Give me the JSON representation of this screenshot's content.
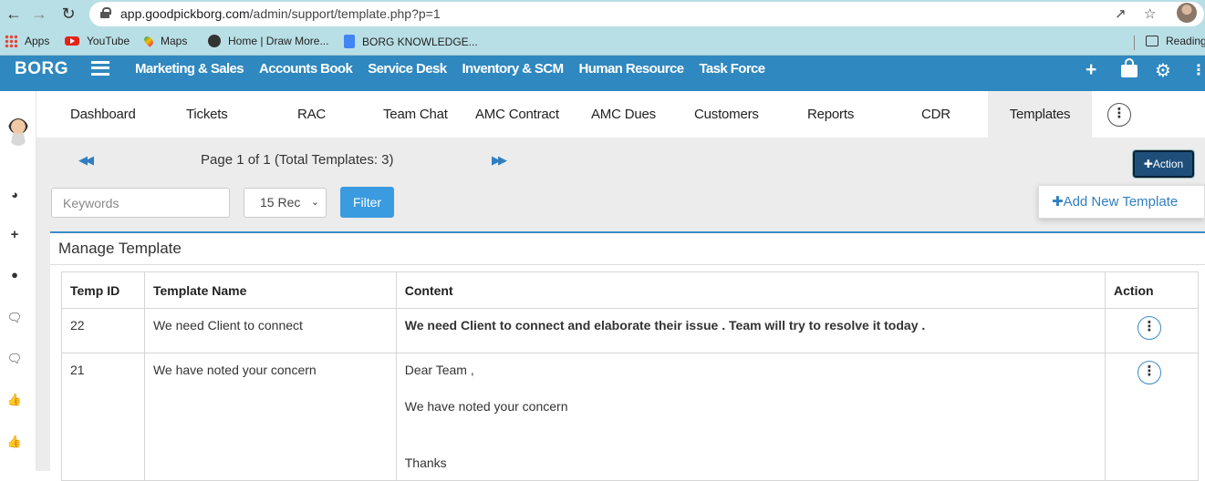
{
  "browser": {
    "url_host": "app.goodpickborg.com",
    "url_path": "/admin/support/template.php?p=1",
    "bookmarks": [
      "Apps",
      "YouTube",
      "Maps",
      "Home | Draw More...",
      "BORG KNOWLEDGE..."
    ],
    "reading_list": "Reading"
  },
  "header": {
    "brand": "BORG",
    "menu": [
      "Marketing & Sales",
      "Accounts Book",
      "Service Desk",
      "Inventory & SCM",
      "Human Resource",
      "Task Force"
    ]
  },
  "subnav": {
    "tabs": [
      "Dashboard",
      "Tickets",
      "RAC",
      "Team Chat",
      "AMC Contract",
      "AMC Dues",
      "Customers",
      "Reports",
      "CDR",
      "Templates"
    ],
    "active": "Templates"
  },
  "pager": {
    "info": "Page 1 of 1 (Total Templates: 3)"
  },
  "action_button": {
    "label": "Action"
  },
  "action_menu": {
    "add_new": "Add New Template"
  },
  "filters": {
    "keywords_placeholder": "Keywords",
    "records": "15 Rec",
    "filter_label": "Filter"
  },
  "panel": {
    "title": "Manage Template"
  },
  "table": {
    "headers": [
      "Temp ID",
      "Template Name",
      "Content",
      "Action"
    ],
    "rows": [
      {
        "id": "22",
        "name": "We need Client to connect",
        "content": [
          "We need Client  to connect and elaborate their issue .  Team will try to resolve it today ."
        ]
      },
      {
        "id": "21",
        "name": "We have noted your concern",
        "content": [
          "Dear Team ,",
          "We have noted your concern",
          "Thanks"
        ]
      }
    ]
  },
  "colors": {
    "header_bg": "#2f88bf",
    "accent": "#3b8bc6",
    "action_btn": "#1e4f7a",
    "filter_btn": "#3b9be0",
    "browser_bar": "#b9dfe6"
  }
}
